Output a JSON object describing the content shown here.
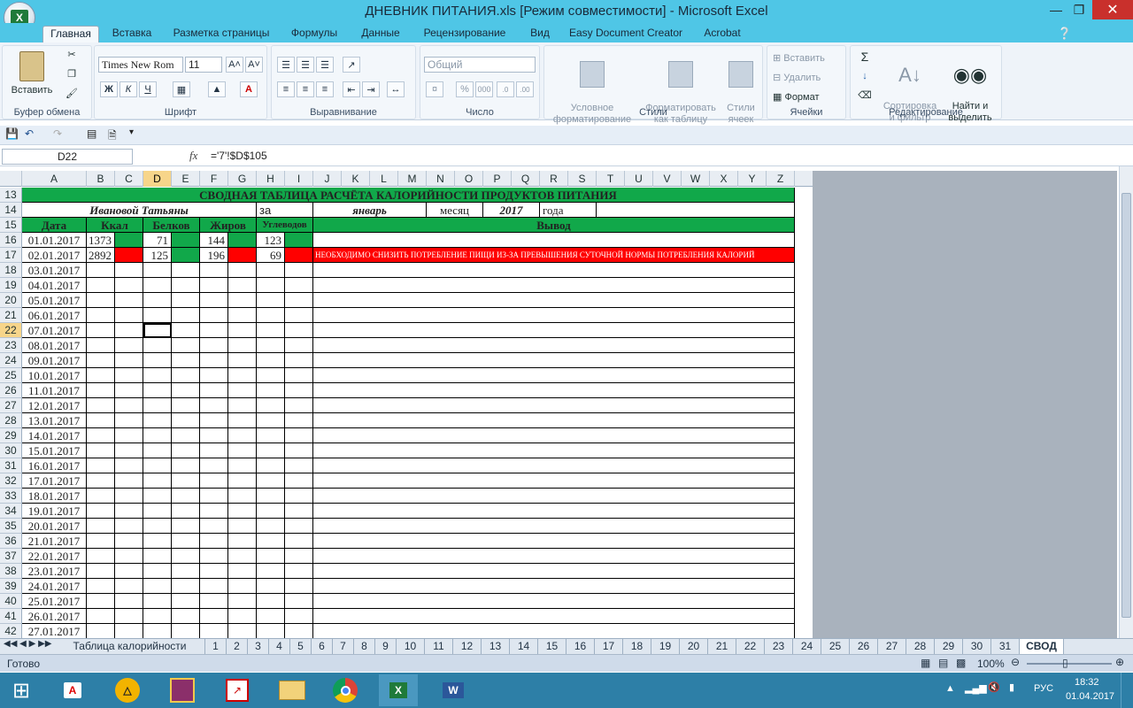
{
  "window": {
    "title": "ДНЕВНИК ПИТАНИЯ.xls  [Режим совместимости] - Microsoft Excel"
  },
  "ribbon_tabs": [
    "Главная",
    "Вставка",
    "Разметка страницы",
    "Формулы",
    "Данные",
    "Рецензирование",
    "Вид",
    "Easy Document Creator",
    "Acrobat"
  ],
  "ribbon": {
    "clipboard": {
      "label": "Буфер обмена",
      "paste": "Вставить"
    },
    "font": {
      "label": "Шрифт",
      "font_name": "Times New Rom",
      "font_size": "11",
      "bold": "Ж",
      "italic": "К",
      "underline": "Ч"
    },
    "alignment": {
      "label": "Выравнивание"
    },
    "number": {
      "label": "Число",
      "format": "Общий"
    },
    "styles": {
      "label": "Стили",
      "cond_format": "Условное\nформатирование",
      "format_table": "Форматировать\nкак таблицу",
      "cell_styles": "Стили\nячеек"
    },
    "cells": {
      "label": "Ячейки",
      "insert": "Вставить",
      "delete": "Удалить",
      "format": "Формат"
    },
    "editing": {
      "label": "Редактирование",
      "sort": "Сортировка\nи фильтр",
      "find": "Найти и\nвыделить"
    }
  },
  "formula_bar": {
    "name_box": "D22",
    "formula": "='7'!$D$105",
    "fx": "fx"
  },
  "columns": [
    "A",
    "B",
    "C",
    "D",
    "E",
    "F",
    "G",
    "H",
    "I",
    "J",
    "K",
    "L",
    "M",
    "N",
    "O",
    "P",
    "Q",
    "R",
    "S",
    "T",
    "U",
    "V",
    "W",
    "X",
    "Y",
    "Z"
  ],
  "sheet": {
    "title": "СВОДНАЯ ТАБЛИЦА  РАСЧЁТА КАЛОРИЙНОСТИ ПРОДУКТОВ ПИТАНИЯ",
    "name": "Ивановой Татьяны",
    "za": "за",
    "month": "январь",
    "mesyac": "месяц",
    "year": "2017",
    "goda": "года",
    "headers": {
      "date": "Дата",
      "kcal": "Ккал",
      "protein": "Белков",
      "fat": "Жиров",
      "carb": "Углеводов",
      "output": "Вывод"
    },
    "row16": {
      "date": "01.01.2017",
      "kcal": "1373",
      "protein": "71",
      "fat": "144",
      "carb": "123"
    },
    "row17": {
      "date": "02.01.2017",
      "kcal": "2892",
      "protein": "125",
      "fat": "196",
      "carb": "69",
      "output": "НЕОБХОДИМО СНИЗИТЬ ПОТРЕБЛЕНИЕ ПИЩИ ИЗ-ЗА ПРЕВЫШЕНИЯ СУТОЧНОЙ НОРМЫ ПОТРЕБЛЕНИЯ КАЛОРИЙ"
    },
    "dates": [
      "03.01.2017",
      "04.01.2017",
      "05.01.2017",
      "06.01.2017",
      "07.01.2017",
      "08.01.2017",
      "09.01.2017",
      "10.01.2017",
      "11.01.2017",
      "12.01.2017",
      "13.01.2017",
      "14.01.2017",
      "15.01.2017",
      "16.01.2017",
      "17.01.2017",
      "18.01.2017",
      "19.01.2017",
      "20.01.2017",
      "21.01.2017",
      "22.01.2017",
      "23.01.2017",
      "24.01.2017",
      "25.01.2017",
      "26.01.2017",
      "27.01.2017"
    ],
    "row_numbers": [
      "13",
      "14",
      "15",
      "16",
      "17",
      "18",
      "19",
      "20",
      "21",
      "22",
      "23",
      "24",
      "25",
      "26",
      "27",
      "28",
      "29",
      "30",
      "31",
      "32",
      "33",
      "34",
      "35",
      "36",
      "37",
      "38",
      "39",
      "40",
      "41",
      "42"
    ]
  },
  "sheet_tabs": [
    "Таблица калорийности",
    "1",
    "2",
    "3",
    "4",
    "5",
    "6",
    "7",
    "8",
    "9",
    "10",
    "11",
    "12",
    "13",
    "14",
    "15",
    "16",
    "17",
    "18",
    "19",
    "20",
    "21",
    "22",
    "23",
    "24",
    "25",
    "26",
    "27",
    "28",
    "29",
    "30",
    "31",
    "СВОД"
  ],
  "status": {
    "ready": "Готово",
    "zoom": "100%"
  },
  "tray": {
    "lang": "РУС",
    "time": "18:32",
    "date": "01.04.2017"
  }
}
